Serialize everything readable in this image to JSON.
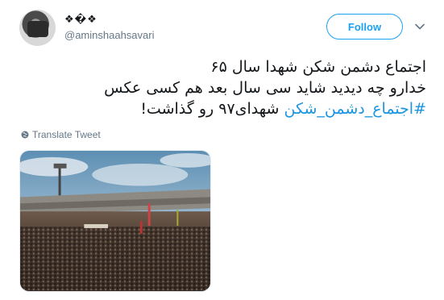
{
  "author": {
    "name": "❖�❖",
    "handle": "@aminshaahsavari"
  },
  "follow_button": {
    "label": "Follow"
  },
  "tweet": {
    "line1": "اجتماع دشمن شکن شهدا سال ۶۵",
    "line2": "خدارو چه دیدید شاید سی سال بعد هم کسی عکس",
    "line3_hashtag": "#اجتماع_دشمن_شکن",
    "line3_rest": " شهدای۹۷ رو گذاشت!"
  },
  "translate_link": {
    "label": "Translate Tweet"
  },
  "colors": {
    "accent": "#1da1f2",
    "hashtag": "#1b95e0",
    "muted": "#657786"
  },
  "icons": [
    "globe-icon",
    "chevron-down-icon"
  ]
}
